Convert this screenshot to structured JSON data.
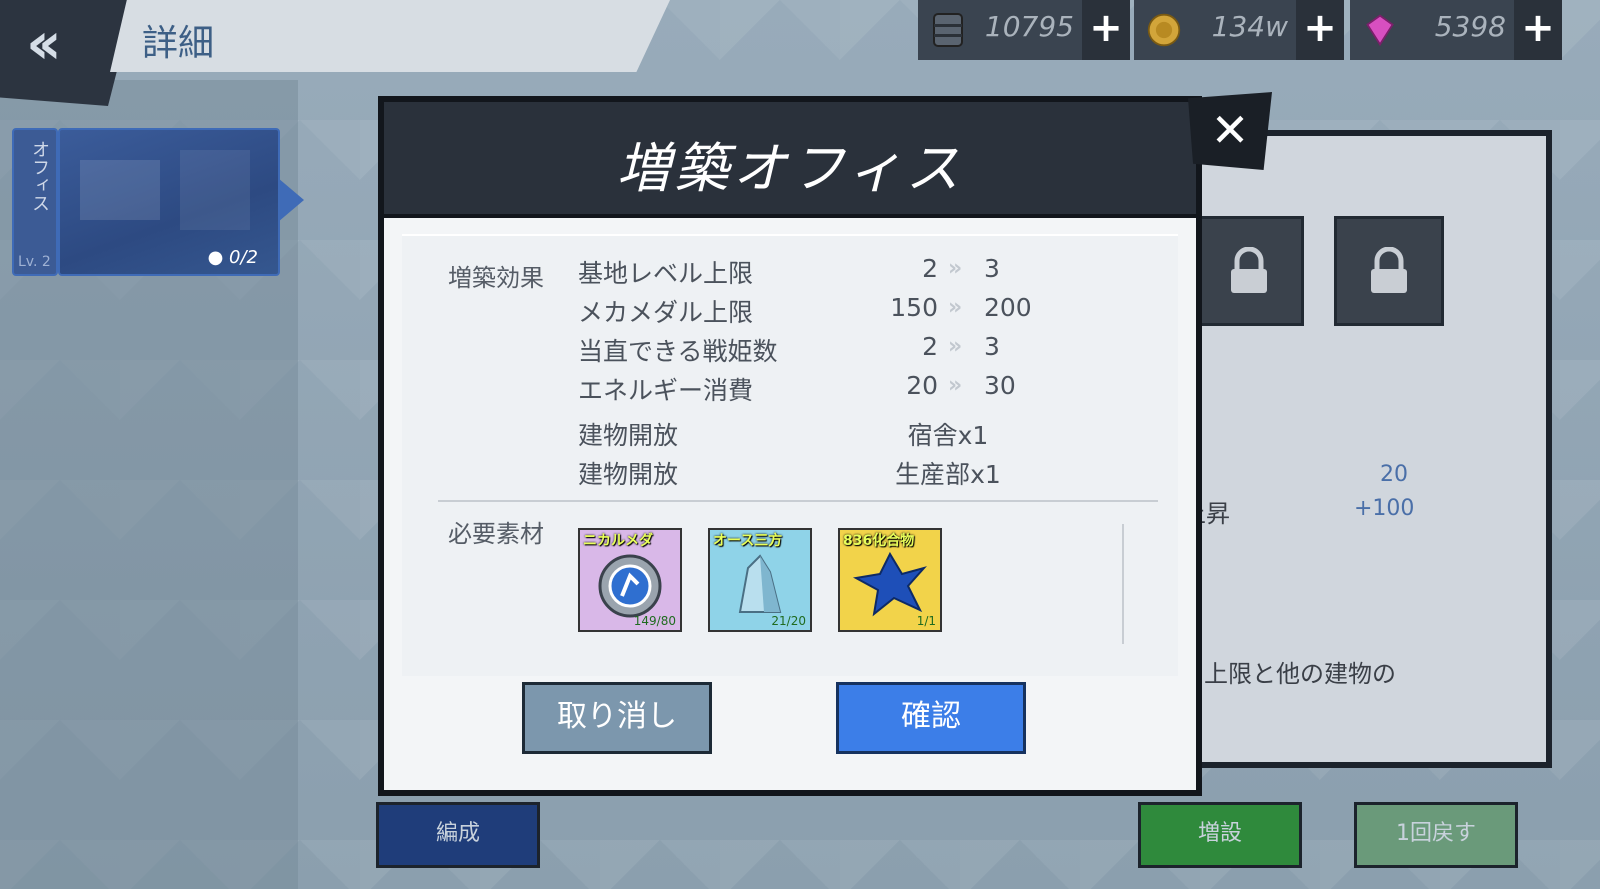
{
  "header": {
    "title": "詳細"
  },
  "resources": [
    {
      "icon": "fuel-barrel-icon",
      "value": "10795"
    },
    {
      "icon": "gold-coin-icon",
      "value": "134w"
    },
    {
      "icon": "gem-icon",
      "value": "5398"
    }
  ],
  "plus_label": "+",
  "facility": {
    "name_vertical": "オフィス",
    "level": "Lv. 2",
    "occupancy": "0/2"
  },
  "background": {
    "value_1": "20",
    "value_2": "+100",
    "up_text": "上昇",
    "description": "の上限と他の建物の",
    "buttons": {
      "formation": "編成",
      "expand": "増設",
      "undo": "1回戻す"
    }
  },
  "modal": {
    "title": "増築オフィス",
    "close_label": "✕",
    "effects_label": "増築効果",
    "effects": [
      {
        "label": "基地レベル上限",
        "from": "2",
        "to": "3"
      },
      {
        "label": "メカメダル上限",
        "from": "150",
        "to": "200"
      },
      {
        "label": "当直できる戦姫数",
        "from": "2",
        "to": "3"
      },
      {
        "label": "エネルギー消費",
        "from": "20",
        "to": "30"
      }
    ],
    "unlocks": [
      {
        "label": "建物開放",
        "value": "宿舎x1"
      },
      {
        "label": "建物開放",
        "value": "生産部x1"
      }
    ],
    "arrow_glyph": "»",
    "materials_label": "必要素材",
    "materials": [
      {
        "name": "ニカルメダ",
        "count": "149/80",
        "bg": "#d9b8e8",
        "icon": "mechanical-medal-icon"
      },
      {
        "name": "オース三方",
        "count": "21/20",
        "bg": "#8fd3e8",
        "icon": "crystal-icon"
      },
      {
        "name": "836化合物",
        "count": "1/1",
        "bg": "#f2d34a",
        "icon": "compound-icon"
      }
    ],
    "cancel_label": "取り消し",
    "confirm_label": "確認"
  }
}
